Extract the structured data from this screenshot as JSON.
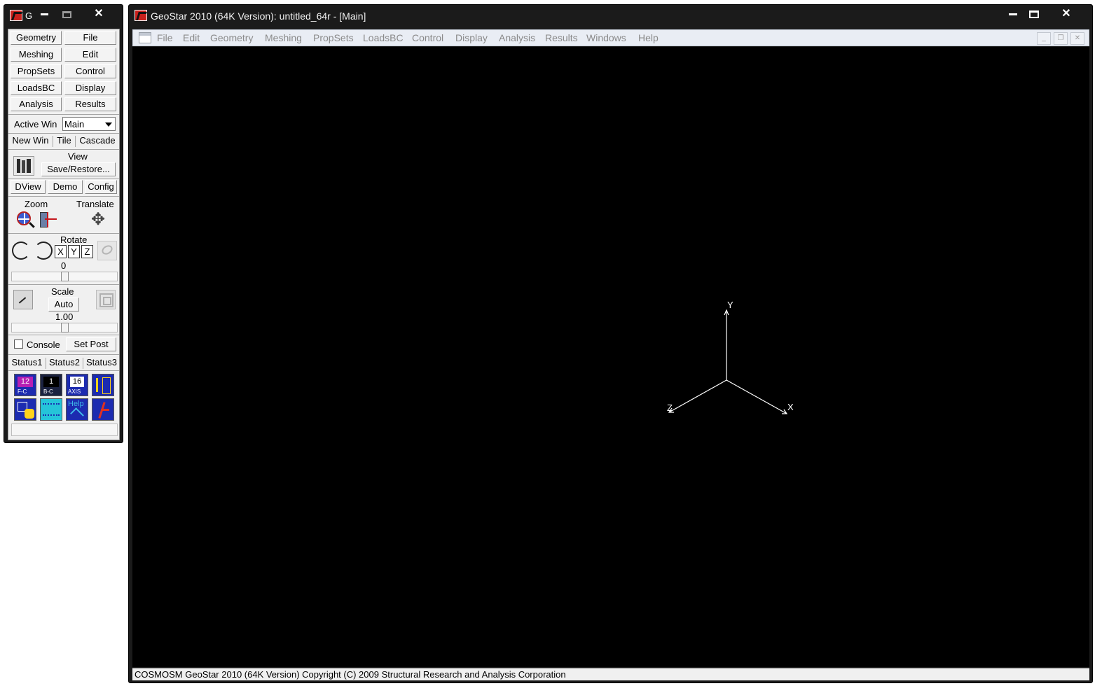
{
  "toolbox": {
    "title": "G",
    "buttons": {
      "geometry": "Geometry",
      "file": "File",
      "meshing": "Meshing",
      "edit": "Edit",
      "propsets": "PropSets",
      "control": "Control",
      "loadsbc": "LoadsBC",
      "display": "Display",
      "analysis": "Analysis",
      "results": "Results"
    },
    "active_win_label": "Active Win",
    "active_win_value": "Main",
    "new_win": "New Win",
    "tile": "Tile",
    "cascade": "Cascade",
    "view_label": "View",
    "save_restore": "Save/Restore...",
    "dview": "DView",
    "demo": "Demo",
    "config": "Config",
    "zoom_label": "Zoom",
    "translate_label": "Translate",
    "rotate_label": "Rotate",
    "axes": [
      "X",
      "Y",
      "Z"
    ],
    "rotate_value": "0",
    "scale_label": "Scale",
    "scale_auto": "Auto",
    "scale_value": "1.00",
    "console": "Console",
    "setpost": "Set Post",
    "status1": "Status1",
    "status2": "Status2",
    "status3": "Status3",
    "icon_texts": {
      "f_c": "12",
      "b_c": "1",
      "axis": "16",
      "help": "Help"
    }
  },
  "main": {
    "title": "GeoStar 2010 (64K Version): untitled_64r - [Main]",
    "menu": [
      "File",
      "Edit",
      "Geometry",
      "Meshing",
      "PropSets",
      "LoadsBC",
      "Control",
      "Display",
      "Analysis",
      "Results",
      "Windows",
      "Help"
    ],
    "triad": {
      "x": "X",
      "y": "Y",
      "z": "Z"
    },
    "status": "COSMOSM GeoStar 2010 (64K Version) Copyright (C) 2009  Structural Research and Analysis Corporation"
  },
  "colors": {
    "frame": "#1b1b1b",
    "viewport": "#000000",
    "menubar": "#e9edf4",
    "panel": "#f0f0f0",
    "brand_red": "#c8201c"
  }
}
